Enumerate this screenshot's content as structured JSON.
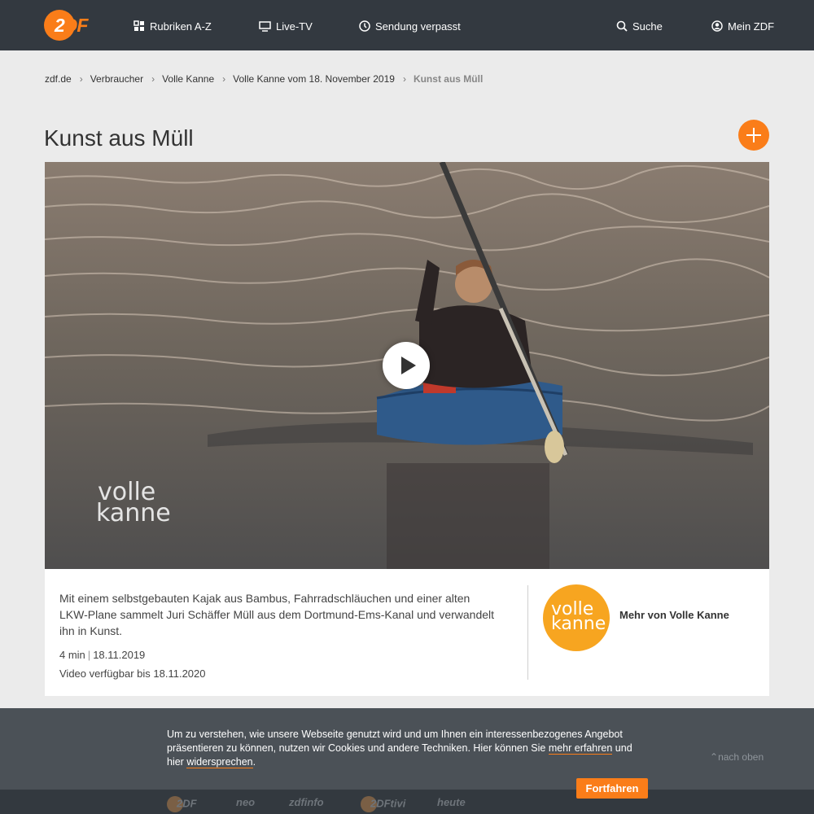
{
  "header": {
    "logo_text_a": "2",
    "logo_text_b": "DF",
    "nav": {
      "rubriken": "Rubriken A-Z",
      "live": "Live-TV",
      "verpasst": "Sendung verpasst",
      "suche": "Suche",
      "mein": "Mein ZDF"
    },
    "icons": [
      "grid-icon",
      "tv-icon",
      "clock-icon",
      "search-icon",
      "user-icon"
    ]
  },
  "breadcrumb": {
    "items": [
      "zdf.de",
      "Verbraucher",
      "Volle Kanne",
      "Volle Kanne vom 18. November 2019"
    ],
    "current": "Kunst aus Müll"
  },
  "page": {
    "title": "Kunst aus Müll"
  },
  "video": {
    "watermark_line1": "volle",
    "watermark_line2": "kanne"
  },
  "info": {
    "description": "Mit einem selbstgebauten Kajak aus Bambus, Fahrradschläuchen und einer alten LKW-Plane sammelt Juri Schäffer Müll aus dem Dortmund-Ems-Kanal und verwandelt ihn in Kunst.",
    "duration": "4 min",
    "date": "18.11.2019",
    "availability": "Video verfügbar bis 18.11.2020",
    "brand_thumb_line1": "volle",
    "brand_thumb_line2": "kanne",
    "more_link": "Mehr von Volle Kanne"
  },
  "cookie": {
    "text_1": "Um zu verstehen, wie unsere Webseite genutzt wird und um Ihnen ein interessenbezogenes Angebot präsentieren zu können, nutzen wir Cookies und andere Techniken. Hier können Sie ",
    "link_1": "mehr erfahren",
    "text_2": " und hier ",
    "link_2": "widersprechen",
    "text_3": ".",
    "button": "Fortfahren",
    "to_top": "nach oben"
  },
  "footer": {
    "logos": [
      "2DF",
      "neo",
      "zdfinfo",
      "2DFtivi",
      "heute"
    ]
  },
  "colors": {
    "brand_orange": "#fa7d19",
    "header_bg": "#333940",
    "page_bg": "#ebebeb"
  }
}
